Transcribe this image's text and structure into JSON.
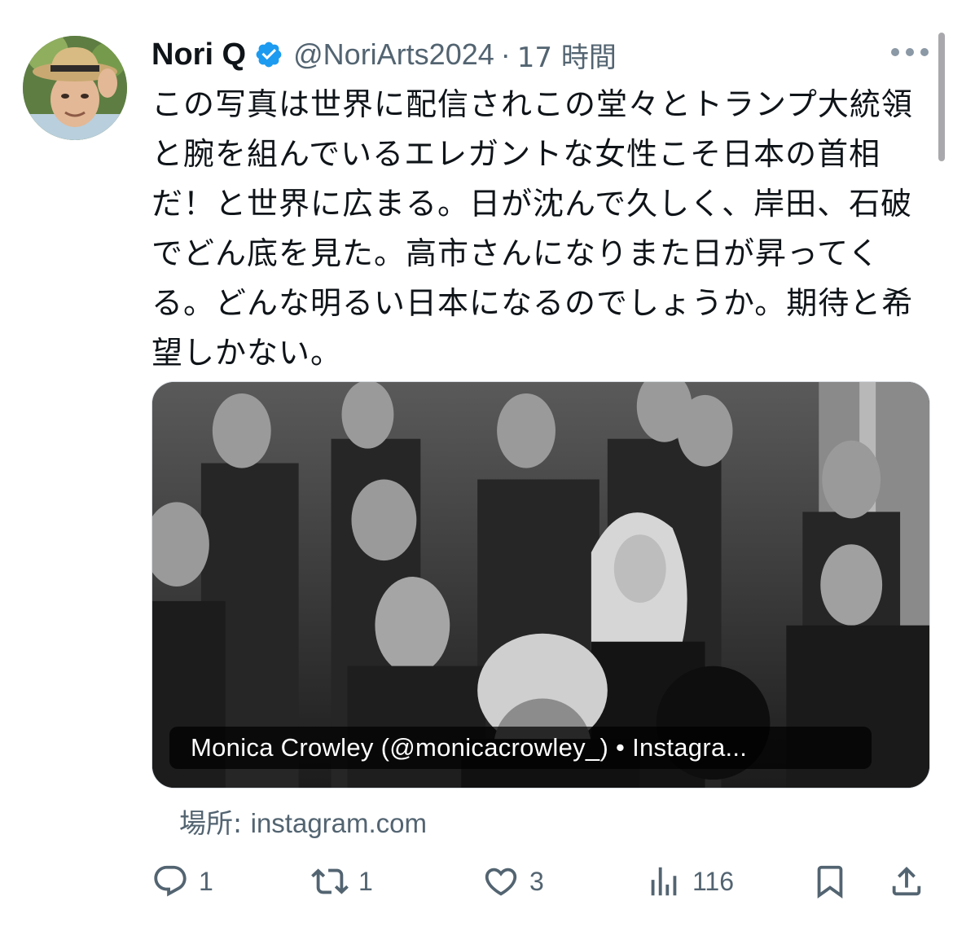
{
  "tweet": {
    "display_name": "Nori Q",
    "verified_icon": "verified-badge-icon",
    "handle": "@NoriArts2024",
    "separator": "·",
    "time": "17 時間",
    "text": "この写真は世界に配信されこの堂々とトランプ大統領と腕を組んでいるエレガントな女性こそ日本の首相だ！と世界に広まる。日が沈んで久しく、岸田、石破でどん底を見た。高市さんになりまた日が昇ってくる。どんな明るい日本になるのでしょうか。期待と希望しかない。",
    "media_caption": "Monica Crowley (@monicacrowley_) • Instagra...",
    "source_label": "場所: ",
    "source_domain": "instagram.com"
  },
  "actions": {
    "reply": {
      "icon": "reply-icon",
      "count": "1"
    },
    "retweet": {
      "icon": "retweet-icon",
      "count": "1"
    },
    "like": {
      "icon": "heart-icon",
      "count": "3"
    },
    "views": {
      "icon": "views-icon",
      "count": "116"
    },
    "bookmark": {
      "icon": "bookmark-icon"
    },
    "share": {
      "icon": "share-icon"
    }
  },
  "colors": {
    "text": "#0f1419",
    "secondary": "#536471",
    "verified": "#1d9bf0"
  }
}
